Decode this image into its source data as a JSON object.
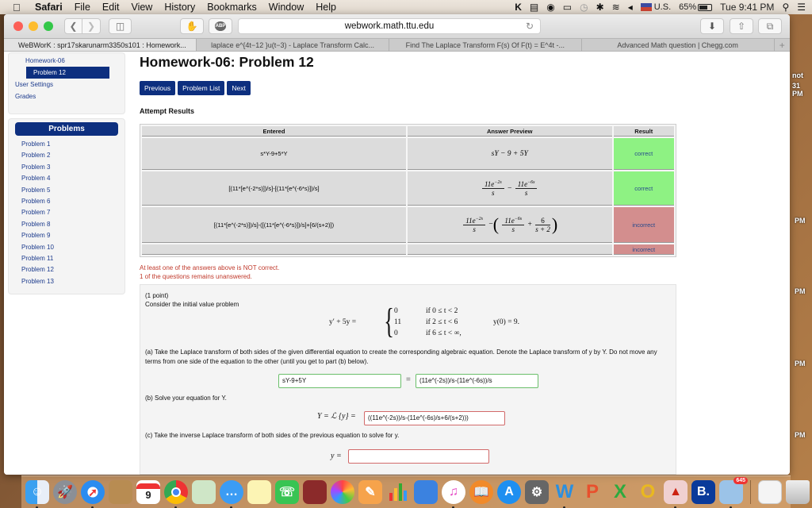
{
  "menubar": {
    "app": "Safari",
    "items": [
      "File",
      "Edit",
      "View",
      "History",
      "Bookmarks",
      "Window",
      "Help"
    ],
    "input_source": "U.S.",
    "battery": "65%",
    "clock": "Tue 9:41 PM",
    "status_icons": [
      "k-icon",
      "radio-icon",
      "swirl-icon",
      "airplay-icon",
      "time-machine-icon",
      "bluetooth-icon",
      "wifi-icon",
      "volume-icon"
    ]
  },
  "browser": {
    "url": "webwork.math.ttu.edu",
    "extension_label": "ABP",
    "tabs": [
      {
        "title": "WeBWorK : spr17skarunarm3350s101 : Homework...",
        "active": true
      },
      {
        "title": "laplace e^{4t−12 }u(t−3) - Laplace Transform Calc...",
        "active": false
      },
      {
        "title": "Find The Laplace Transform F(s) Of F(t) = E^4t -...",
        "active": false
      },
      {
        "title": "Advanced Math question | Chegg.com",
        "active": false
      }
    ],
    "new_tab": "+"
  },
  "sidebar": {
    "links": [
      {
        "label": "Homework-06",
        "level": 1
      },
      {
        "label": "Problem 12",
        "level": 2,
        "active": true
      },
      {
        "label": "User Settings",
        "level": 0
      },
      {
        "label": "Grades",
        "level": 0
      }
    ],
    "problems_header": "Problems",
    "problems": [
      "Problem 1",
      "Problem 2",
      "Problem 3",
      "Problem 4",
      "Problem 5",
      "Problem 6",
      "Problem 7",
      "Problem 8",
      "Problem 9",
      "Problem 10",
      "Problem 11",
      "Problem 12",
      "Problem 13"
    ]
  },
  "page": {
    "title": "Homework-06: Problem 12",
    "buttons": {
      "previous": "Previous",
      "problem_list": "Problem List",
      "next": "Next"
    },
    "attempt_results_title": "Attempt Results",
    "results_table": {
      "headers": [
        "Entered",
        "Answer Preview",
        "Result"
      ],
      "rows": [
        {
          "entered": "s*Y-9+5*Y",
          "preview": "sY − 9 + 5Y",
          "result": "correct"
        },
        {
          "entered": "[(11*[e^(-2*s)])/s]-[(11*[e^(-6*s)])/s]",
          "preview": "11e^{−2s}/s − 11e^{−6s}/s",
          "result": "correct"
        },
        {
          "entered": "[(11*[e^(-2*s)])/s]-([(11*[e^(-6*s)])/s]+[6/(s+2)])",
          "preview": "11e^{−2s}/s − (11e^{−6s}/s + 6/(s+2))",
          "result": "incorrect"
        },
        {
          "entered": "",
          "preview": "",
          "result": "incorrect"
        }
      ]
    },
    "messages": [
      "At least one of the answers above is NOT correct.",
      "1 of the questions remains unanswered."
    ],
    "problem": {
      "points": "(1 point)",
      "intro": "Consider the initial value problem",
      "ivp_lhs": "y′ + 5y =",
      "cases": [
        {
          "value": "0",
          "condition": "if 0 ≤ t < 2"
        },
        {
          "value": "11",
          "condition": "if 2 ≤ t < 6"
        },
        {
          "value": "0",
          "condition": "if 6 ≤ t < ∞,"
        }
      ],
      "initial_condition": "y(0) = 9.",
      "part_a_text": "(a) Take the Laplace transform of both sides of the given differential equation to create the corresponding algebraic equation. Denote the Laplace transform of y by Y. Do not move any terms from one side of the equation to the other (until you get to part (b) below).",
      "part_a_lhs_value": "sY-9+5Y",
      "part_a_eq": "=",
      "part_a_rhs_value": "(11e^(-2s))/s-(11e^(-6s))/s",
      "part_b_text": "(b) Solve your equation for Y.",
      "part_b_label": "Y = ℒ {y} =",
      "part_b_value": "((11e^(-2s))/s-(11e^(-6s)/s+6/(s+2)))",
      "part_c_text": "(c) Take the inverse Laplace transform of both sides of the previous equation to solve for y.",
      "part_c_label": "y =",
      "part_c_value": ""
    }
  },
  "desktop_labels": [
    "not",
    "31 PM",
    "PM",
    "PM",
    "PM",
    "PM"
  ],
  "dock": {
    "apps": [
      "Finder",
      "Launchpad",
      "Safari",
      "Contacts",
      "Calendar",
      "Chrome",
      "Maps",
      "Messages",
      "Notes",
      "FaceTime",
      "Photo Booth",
      "Photos",
      "Pages",
      "Numbers",
      "Keynote",
      "iTunes",
      "iBooks",
      "App Store",
      "System Preferences",
      "Word",
      "PowerPoint",
      "Excel",
      "Outlook",
      "AutoCAD",
      "Booking",
      "Mail",
      "Chrome Document",
      "Trash"
    ],
    "calendar_day": "9",
    "mail_badge": "645"
  },
  "colors": {
    "webwork_blue": "#0d2f7f",
    "correct_green": "#8ef283",
    "incorrect_red": "#d38e8e",
    "message_red": "#c0392b"
  }
}
